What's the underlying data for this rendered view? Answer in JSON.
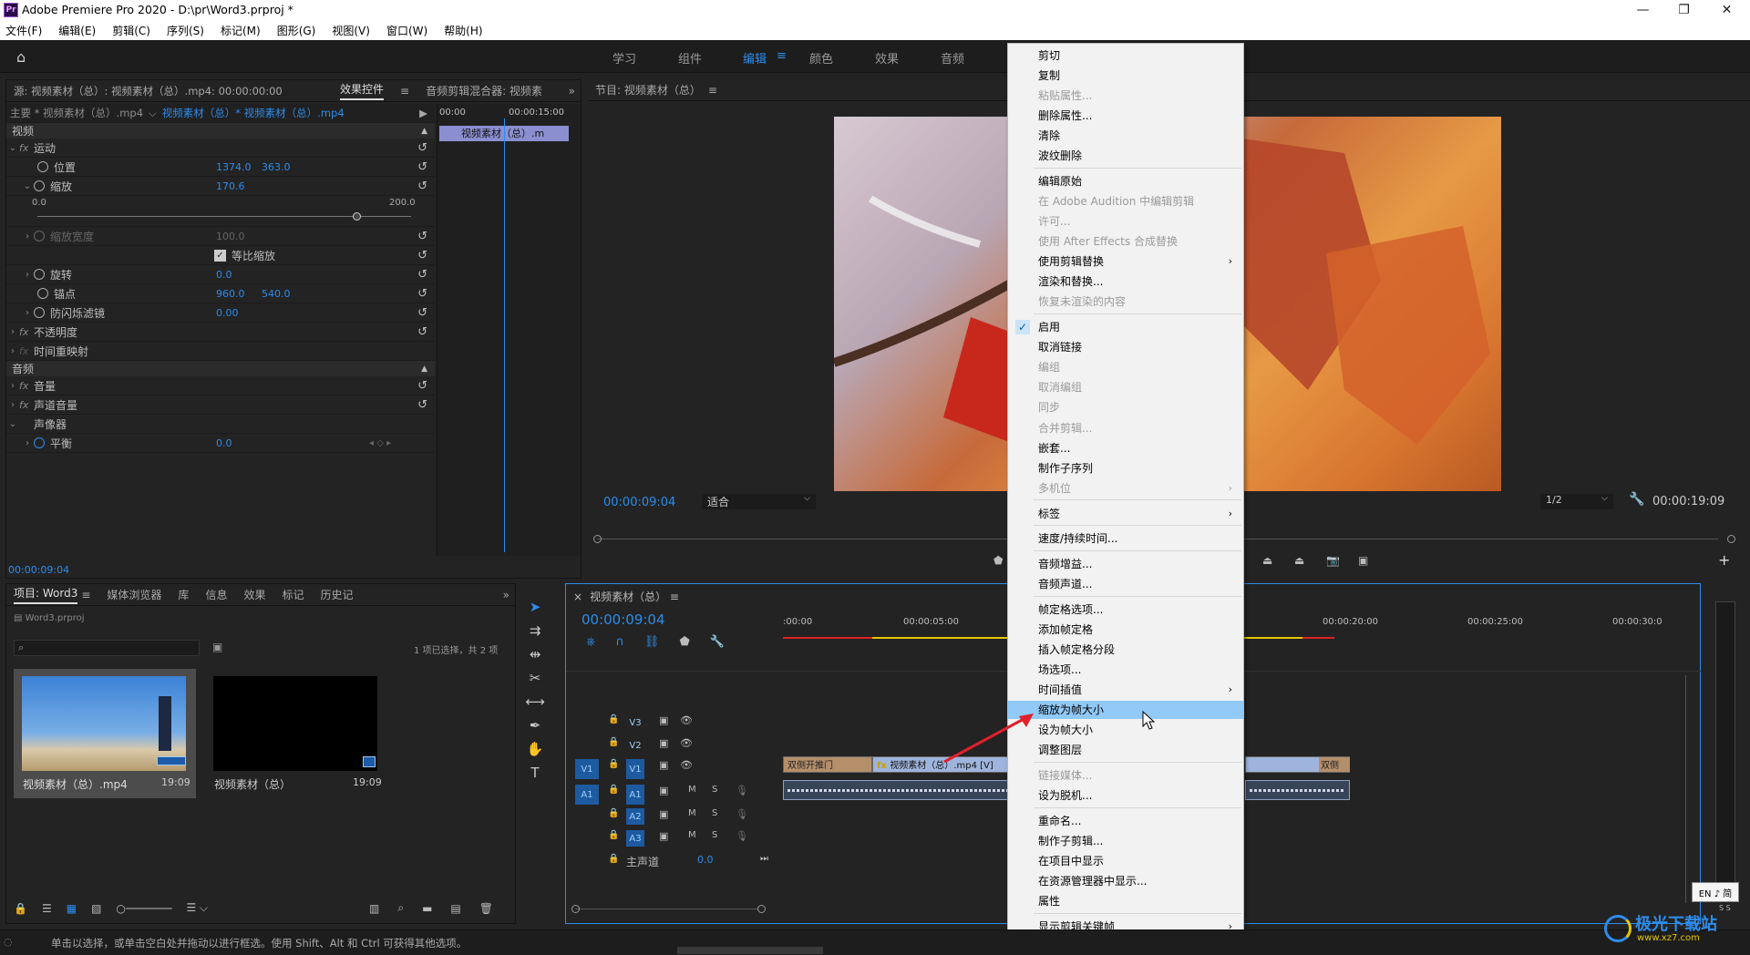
{
  "titlebar": {
    "icon": "Pr",
    "title": "Adobe Premiere Pro 2020 - D:\\pr\\Word3.prproj *",
    "minimize": "—",
    "restore": "❐",
    "close": "✕"
  },
  "menubar": [
    "文件(F)",
    "编辑(E)",
    "剪辑(C)",
    "序列(S)",
    "标记(M)",
    "图形(G)",
    "视图(V)",
    "窗口(W)",
    "帮助(H)"
  ],
  "workspaces": {
    "items": [
      "学习",
      "组件",
      "编辑",
      "颜色",
      "效果",
      "音频"
    ],
    "active": "编辑"
  },
  "source_panel": {
    "tab_source": "源: 视频素材（总）: 视频素材（总）.mp4: 00:00:00:00",
    "tab_effects": "效果控件",
    "tab_mixer": "音频剪辑混合器: 视频素",
    "master": "主要 * 视频素材（总）.mp4",
    "clip": "视频素材（总）* 视频素材（总）.mp4",
    "mini_timecode": "00:00",
    "mini_timecode2": "00:00:15:00",
    "mini_clip": "视频素材（总）.m",
    "video_header": "视频",
    "motion": "运动",
    "position": "位置",
    "position_x": "1374.0",
    "position_y": "363.0",
    "scale": "缩放",
    "scale_val": "170.6",
    "slider_min": "0.0",
    "slider_max": "200.0",
    "scale_fraction": 0.853,
    "scale_width": "缩放宽度",
    "scale_width_val": "100.0",
    "uniform": "等比缩放",
    "rotation": "旋转",
    "rotation_val": "0.0",
    "anchor": "锚点",
    "anchor_x": "960.0",
    "anchor_y": "540.0",
    "antiflicker": "防闪烁滤镜",
    "antiflicker_val": "0.00",
    "opacity": "不透明度",
    "time_remap": "时间重映射",
    "audio_header": "音频",
    "volume": "音量",
    "channel_volume": "声道音量",
    "panner": "声像器",
    "balance": "平衡",
    "balance_val": "0.0",
    "timecode": "00:00:09:04"
  },
  "program": {
    "title": "节目: 视频素材（总）",
    "timecode": "00:00:09:04",
    "fit": "适合",
    "quality": "1/2",
    "duration": "00:00:19:09"
  },
  "project": {
    "tabs": [
      "项目: Word3",
      "媒体浏览器",
      "库",
      "信息",
      "效果",
      "标记",
      "历史记"
    ],
    "file": "Word3.prproj",
    "selection": "1 项已选择，共 2 项",
    "items": [
      {
        "name": "视频素材（总）.mp4",
        "duration": "19:09"
      },
      {
        "name": "视频素材（总）",
        "duration": "19:09"
      }
    ]
  },
  "timeline": {
    "title": "视频素材（总）",
    "timecode": "00:00:09:04",
    "ruler": [
      ":00:00",
      "00:00:05:00",
      "00:00:20:00",
      "00:00:25:00",
      "00:00:30:0"
    ],
    "tracks": {
      "v3": "V3",
      "v2": "V2",
      "v1": "V1",
      "a1": "A1",
      "a2": "A2",
      "a3": "A3",
      "src_v1": "V1",
      "src_a1": "A1",
      "m": "M",
      "s": "S"
    },
    "master": "主声道",
    "master_val": "0.0",
    "clip_left": "双侧开推门",
    "clip_main": "视频素材（总）.mp4 [V]",
    "clip_right": "双侧"
  },
  "context_menu": {
    "items": [
      {
        "label": "剪切",
        "dis": false
      },
      {
        "label": "复制",
        "dis": false
      },
      {
        "label": "粘贴属性...",
        "dis": true
      },
      {
        "label": "删除属性...",
        "dis": false
      },
      {
        "label": "清除",
        "dis": false
      },
      {
        "label": "波纹删除",
        "dis": false
      },
      {
        "label": "编辑原始",
        "dis": false
      },
      {
        "label": "在 Adobe Audition 中编辑剪辑",
        "dis": true
      },
      {
        "label": "许可...",
        "dis": true
      },
      {
        "label": "使用 After Effects 合成替换",
        "dis": true
      },
      {
        "label": "使用剪辑替换",
        "dis": false,
        "sub": true
      },
      {
        "label": "渲染和替换...",
        "dis": false
      },
      {
        "label": "恢复未渲染的内容",
        "dis": true
      },
      {
        "label": "启用",
        "dis": false,
        "check": true
      },
      {
        "label": "取消链接",
        "dis": false
      },
      {
        "label": "编组",
        "dis": true
      },
      {
        "label": "取消编组",
        "dis": true
      },
      {
        "label": "同步",
        "dis": true
      },
      {
        "label": "合并剪辑...",
        "dis": true
      },
      {
        "label": "嵌套...",
        "dis": false
      },
      {
        "label": "制作子序列",
        "dis": false
      },
      {
        "label": "多机位",
        "dis": true,
        "sub": true
      },
      {
        "label": "标签",
        "dis": false,
        "sub": true
      },
      {
        "label": "速度/持续时间...",
        "dis": false
      },
      {
        "label": "音频增益...",
        "dis": false
      },
      {
        "label": "音频声道...",
        "dis": false
      },
      {
        "label": "帧定格选项...",
        "dis": false
      },
      {
        "label": "添加帧定格",
        "dis": false
      },
      {
        "label": "插入帧定格分段",
        "dis": false
      },
      {
        "label": "场选项...",
        "dis": false
      },
      {
        "label": "时间插值",
        "dis": false,
        "sub": true
      },
      {
        "label": "缩放为帧大小",
        "dis": false,
        "hl": true
      },
      {
        "label": "设为帧大小",
        "dis": false
      },
      {
        "label": "调整图层",
        "dis": false
      },
      {
        "label": "链接媒体...",
        "dis": true
      },
      {
        "label": "设为脱机...",
        "dis": false
      },
      {
        "label": "重命名...",
        "dis": false
      },
      {
        "label": "制作子剪辑...",
        "dis": false
      },
      {
        "label": "在项目中显示",
        "dis": false
      },
      {
        "label": "在资源管理器中显示...",
        "dis": false
      },
      {
        "label": "属性",
        "dis": false
      },
      {
        "label": "显示剪辑关键帧",
        "dis": false,
        "sub": true
      }
    ]
  },
  "statusbar": {
    "hint": "单击以选择，或单击空白处并拖动以进行框选。使用 Shift、Alt 和 Ctrl 可获得其他选项。"
  },
  "ime": {
    "label": "EN ♪ 简",
    "sub": "S S"
  },
  "watermark": {
    "text": "极光下载站",
    "url": "www.xz7.com"
  },
  "colors": {
    "accent": "#2d8ceb",
    "menu_highlight": "#91c9f7",
    "arrow": "#e0202a"
  }
}
